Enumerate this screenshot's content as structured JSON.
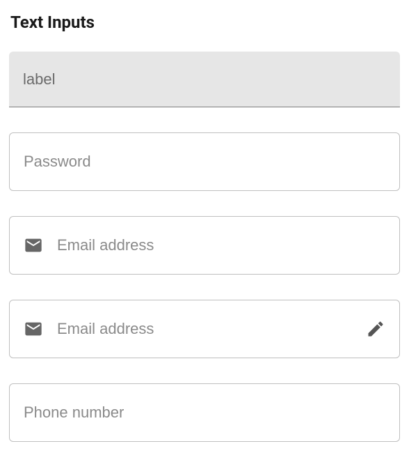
{
  "section": {
    "title": "Text Inputs"
  },
  "fields": {
    "label": {
      "placeholder": "label",
      "value": ""
    },
    "password": {
      "placeholder": "Password",
      "value": ""
    },
    "email1": {
      "placeholder": "Email address",
      "value": ""
    },
    "email2": {
      "placeholder": "Email address",
      "value": ""
    },
    "phone": {
      "placeholder": "Phone number",
      "value": ""
    }
  },
  "icons": {
    "email": "email-icon",
    "edit": "pencil-icon"
  }
}
